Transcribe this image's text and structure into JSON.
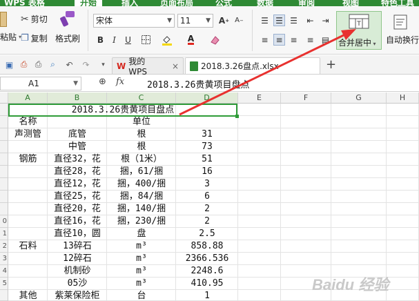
{
  "ribbon_tabs": {
    "app": "WPS 表格",
    "start": "开始",
    "insert": "插入",
    "page_layout": "页面布局",
    "formula": "公式",
    "data": "数据",
    "review": "审阅",
    "view": "视图",
    "special": "特色工具"
  },
  "toolbar": {
    "paste": "粘贴",
    "cut": "剪切",
    "copy": "复制",
    "format_painter": "格式刷",
    "font_name": "宋体",
    "font_size": "11",
    "merge_center": "合并居中",
    "auto_wrap": "自动换行",
    "bold": "B",
    "italic": "I",
    "underline": "U"
  },
  "doc_tabs": {
    "my_wps": "我的WPS",
    "file": "2018.3.26盘点.xlsx"
  },
  "formula_bar": {
    "cell_ref": "A1",
    "fx": "fx",
    "content": "2018.3.26贵黄项目盘点"
  },
  "columns": [
    "A",
    "B",
    "C",
    "D",
    "E",
    "F",
    "G",
    "H"
  ],
  "row_numbers": [
    "",
    "",
    "",
    "",
    "",
    "",
    "",
    "",
    "",
    "0",
    "1",
    "2",
    "3",
    "4",
    "5",
    ""
  ],
  "sheet": {
    "title": "2018.3.26贵黄项目盘点",
    "rows": [
      {
        "a": "名称",
        "b": "",
        "c": "单位",
        "d": ""
      },
      {
        "a": "声测管",
        "b": "底管",
        "c": "根",
        "d": "31"
      },
      {
        "a": "",
        "b": "中管",
        "c": "根",
        "d": "73"
      },
      {
        "a": "钢筋",
        "b": "直径32，花",
        "c": "根（1米）",
        "d": "51"
      },
      {
        "a": "",
        "b": "直径28，花",
        "c": "捆，61/捆",
        "d": "16"
      },
      {
        "a": "",
        "b": "直径12，花",
        "c": "捆，400/捆",
        "d": "3"
      },
      {
        "a": "",
        "b": "直径25，花",
        "c": "捆，84/捆",
        "d": "6"
      },
      {
        "a": "",
        "b": "直径20，花",
        "c": "捆，140/捆",
        "d": "2"
      },
      {
        "a": "",
        "b": "直径16，花",
        "c": "捆，230/捆",
        "d": "2"
      },
      {
        "a": "",
        "b": "直径10，圆",
        "c": "盘",
        "d": "2.5"
      },
      {
        "a": "石料",
        "b": "13碎石",
        "c": "m³",
        "d": "858.88"
      },
      {
        "a": "",
        "b": "12碎石",
        "c": "m³",
        "d": "2366.536"
      },
      {
        "a": "",
        "b": "机制砂",
        "c": "m³",
        "d": "2248.6"
      },
      {
        "a": "",
        "b": "05沙",
        "c": "m³",
        "d": "410.95"
      },
      {
        "a": "其他",
        "b": "紫莱保险柜",
        "c": "台",
        "d": "1"
      }
    ]
  },
  "watermark": "Baidu 经验",
  "colors": {
    "brand_green": "#2f8a35",
    "selection_green": "#2e9b37",
    "arrow_red": "#e8312f"
  }
}
